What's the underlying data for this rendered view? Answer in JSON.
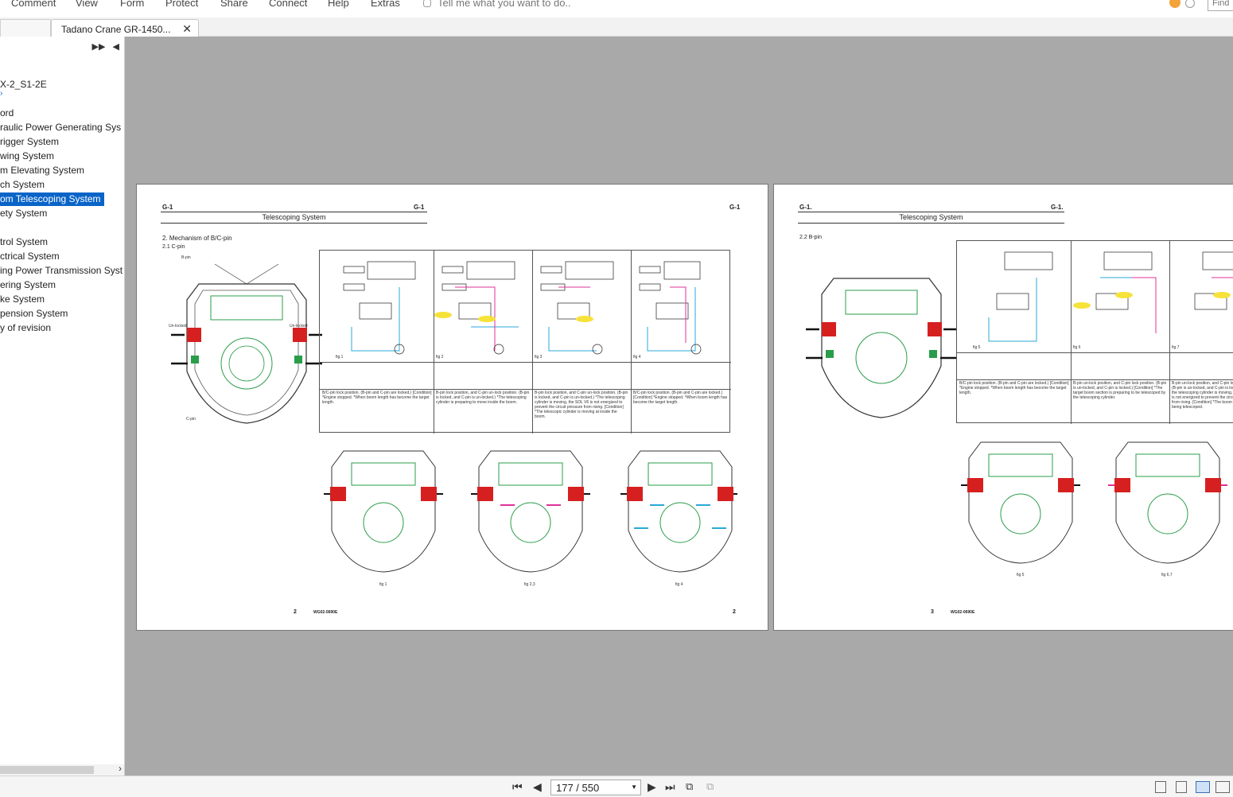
{
  "menu": [
    "Comment",
    "View",
    "Form",
    "Protect",
    "Share",
    "Connect",
    "Help",
    "Extras"
  ],
  "tell_me": "Tell me what you want to do..",
  "find_label": "Find",
  "tab": {
    "title": "Tadano Crane GR-1450..."
  },
  "bookmarks": {
    "items": [
      "X-2_S1-2E",
      "ord",
      "raulic Power Generating Sys",
      "rigger System",
      "wing System",
      "m Elevating System",
      "ch System",
      "om Telescoping System",
      "ety System",
      "trol System",
      "ctrical System",
      "ing Power Transmission Syst",
      "ering System",
      "ke System",
      "pension System",
      "y of revision"
    ],
    "selected_index": 7
  },
  "page_left": {
    "section": "G-1",
    "title": "Telescoping System",
    "heading": "2.  Mechanism of B/C-pin",
    "subheading": "2.1  C-pin",
    "page_number": "2",
    "doc_code": "WG02-0690E",
    "figure_labels": [
      "fig 1",
      "fig 2,3",
      "fig 4"
    ],
    "panel_labels": [
      "fig 1",
      "fig 2",
      "fig 3",
      "fig 4"
    ],
    "captions": [
      "B/C-pin lock position. (B-pin and C-pin are locked.) [Condition] *Engine stopped. *When boom length has become the target length.",
      "B-pin lock position, and C-pin un-lock position. (B-pin is locked, and C-pin is un-locked.) *The telescoping cylinder is preparing to move inside the boom.",
      "B-pin lock position, and C-pin un-lock position. (B-pin is locked, and C-pin is un-locked.) *The telescoping cylinder is moving, the SOL V6 is not energized to prevent the circuit pressure from rising. [Condition] *The telescopic cylinder is moving at inside the boom.",
      "B/C-pin lock position. (B-pin and C-pin are locked.) [Condition] *Engine stopped. *When boom length has become the target length."
    ]
  },
  "page_right": {
    "section": "G-1.",
    "title": "Telescoping System",
    "heading": "2.2  B-pin",
    "page_number": "3",
    "doc_code": "WG02-0690E",
    "figure_labels": [
      "fig 5",
      "fig 6,7"
    ],
    "panel_labels": [
      "fig 5",
      "fig 6",
      "fig 7"
    ],
    "captions": [
      "B/C-pin lock position. (B-pin and C-pin are locked.) [Condition] *Engine stopped. *When boom length has become the target length.",
      "B-pin un-lock position, and C-pin lock position. (B-pin is un-locked, and C-pin is locked.) [Condition] *The target boom section is preparing to be telescoped by the telescoping cylinder.",
      "B-pin un-lock position, and C-pin lock position. (B-pin is un-locked, and C-pin is locked.) *When the telescoping cylinder is moving, the SOL V6 is not energized to prevent the circuit pressure from rising. [Condition] *The boom section is being telescoped."
    ]
  },
  "status": {
    "page_display": "177 / 550"
  },
  "colors": {
    "accent": "#0a64c8",
    "canvas": "#a9a9a9",
    "red_part": "#d62020",
    "green_part": "#2a9d4a",
    "magenta_line": "#e0309a",
    "cyan_line": "#2aa8d8"
  }
}
